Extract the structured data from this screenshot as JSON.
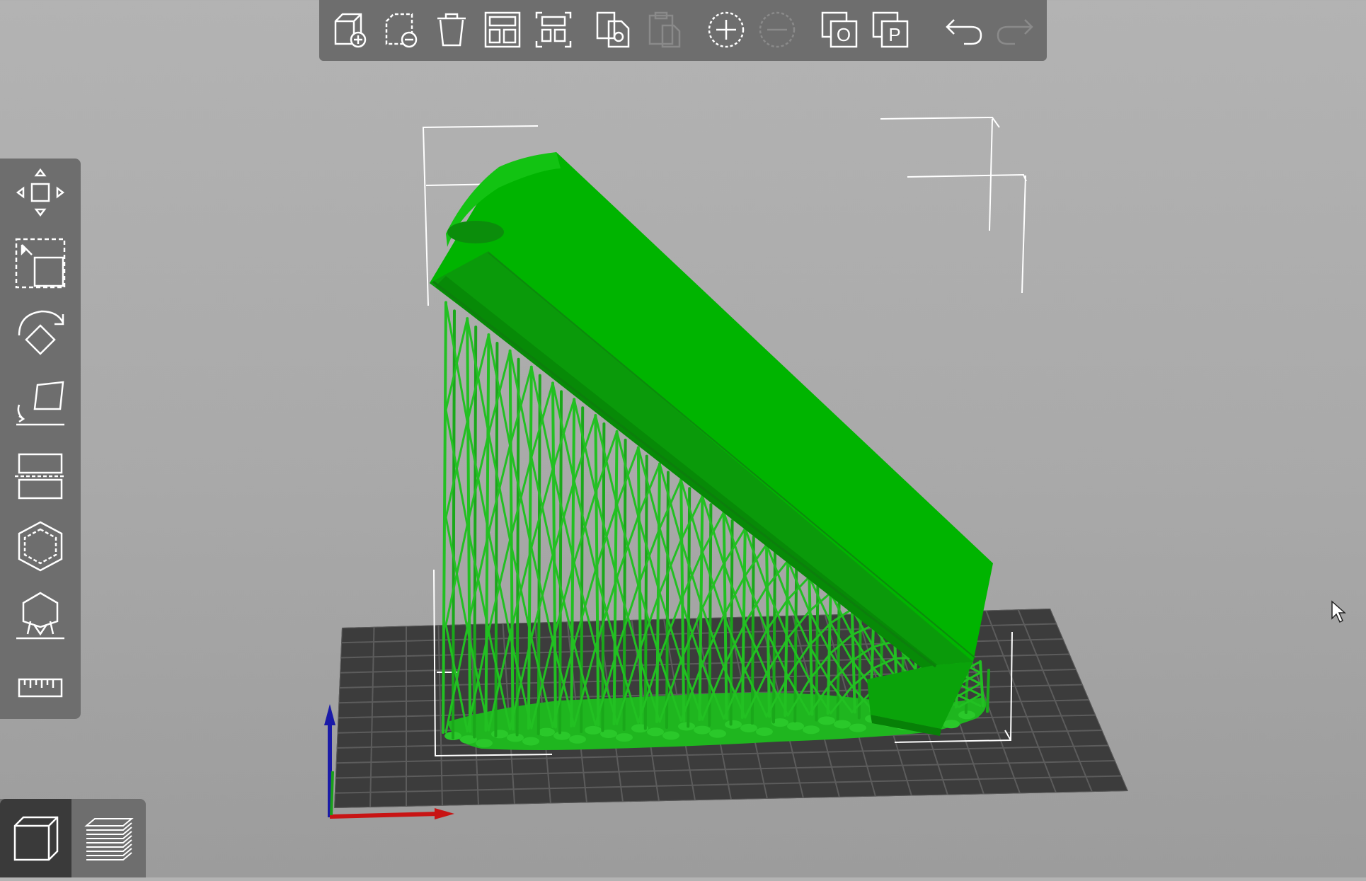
{
  "app": {
    "background_color": "#aaaaaa",
    "toolbar_color": "#6e6e6e",
    "model_color": "#00b300",
    "support_color": "#22c022",
    "bed_color": "#3c3c3c"
  },
  "top_toolbar": {
    "items": [
      {
        "icon": "add-object-icon",
        "enabled": true
      },
      {
        "icon": "delete-selection-icon",
        "enabled": true
      },
      {
        "icon": "delete-all-icon",
        "enabled": true
      },
      {
        "icon": "arrange-icon",
        "enabled": true
      },
      {
        "icon": "arrange-selection-icon",
        "enabled": true
      },
      {
        "icon": "copy-icon",
        "enabled": true
      },
      {
        "icon": "paste-icon",
        "enabled": false
      },
      {
        "icon": "add-instance-icon",
        "enabled": true
      },
      {
        "icon": "remove-instance-icon",
        "enabled": false
      },
      {
        "icon": "split-to-objects-icon",
        "enabled": true,
        "letter": "O"
      },
      {
        "icon": "split-to-parts-icon",
        "enabled": true,
        "letter": "P"
      },
      {
        "icon": "undo-icon",
        "enabled": true
      },
      {
        "icon": "redo-icon",
        "enabled": false
      }
    ]
  },
  "left_toolbar": {
    "items": [
      {
        "icon": "move-icon"
      },
      {
        "icon": "scale-icon"
      },
      {
        "icon": "rotate-icon"
      },
      {
        "icon": "place-on-face-icon"
      },
      {
        "icon": "cut-icon"
      },
      {
        "icon": "hollow-icon"
      },
      {
        "icon": "support-points-icon"
      },
      {
        "icon": "measure-icon"
      }
    ]
  },
  "view_toggle": {
    "active": "3d",
    "items": [
      {
        "icon": "3d-view-icon"
      },
      {
        "icon": "preview-layers-icon"
      }
    ]
  }
}
